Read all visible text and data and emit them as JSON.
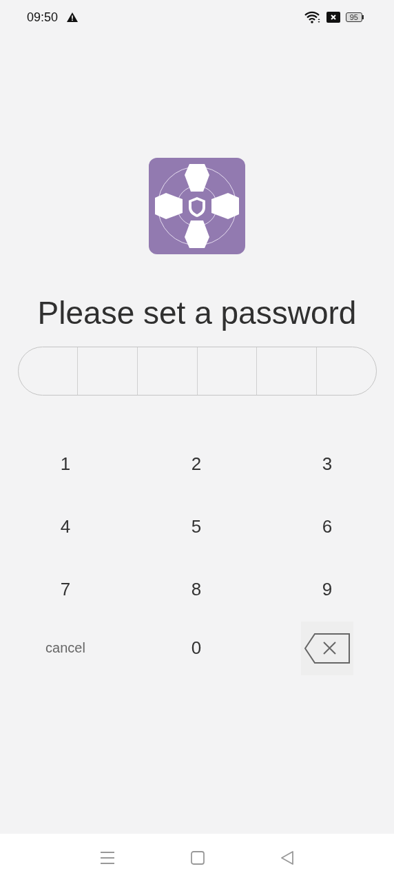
{
  "status_bar": {
    "time": "09:50",
    "battery": "95"
  },
  "title": "Please set a password",
  "keypad": [
    {
      "kind": "digit",
      "label": "1"
    },
    {
      "kind": "digit",
      "label": "2"
    },
    {
      "kind": "digit",
      "label": "3"
    },
    {
      "kind": "digit",
      "label": "4"
    },
    {
      "kind": "digit",
      "label": "5"
    },
    {
      "kind": "digit",
      "label": "6"
    },
    {
      "kind": "digit",
      "label": "7"
    },
    {
      "kind": "digit",
      "label": "8"
    },
    {
      "kind": "digit",
      "label": "9"
    },
    {
      "kind": "action",
      "label": "cancel"
    },
    {
      "kind": "digit",
      "label": "0"
    },
    {
      "kind": "backspace"
    }
  ]
}
